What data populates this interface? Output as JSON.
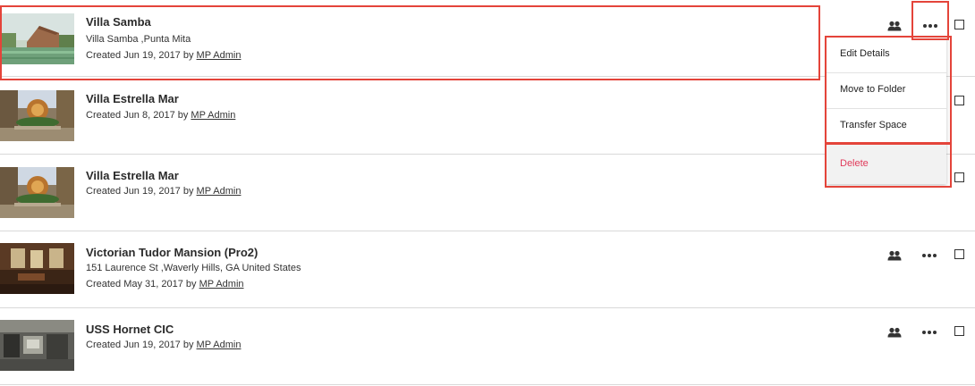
{
  "spaces": [
    {
      "title": "Villa Samba",
      "address": "Villa Samba ,Punta Mita",
      "created_prefix": "Created Jun 19, 2017 by ",
      "created_by": "MP Admin",
      "thumb_icon": "villa-samba-photo"
    },
    {
      "title": "Villa Estrella Mar",
      "address": "",
      "created_prefix": "Created Jun 8, 2017 by ",
      "created_by": "MP Admin",
      "thumb_icon": "villa-estrella-photo"
    },
    {
      "title": "Villa Estrella Mar",
      "address": "",
      "created_prefix": "Created Jun 19, 2017 by ",
      "created_by": "MP Admin",
      "thumb_icon": "villa-estrella-photo"
    },
    {
      "title": "Victorian Tudor Mansion (Pro2)",
      "address": "151 Laurence St ,Waverly Hills, GA United States",
      "created_prefix": "Created May 31, 2017 by ",
      "created_by": "MP Admin",
      "thumb_icon": "mansion-interior-photo"
    },
    {
      "title": "USS Hornet CIC",
      "address": "",
      "created_prefix": "Created Jun 19, 2017 by ",
      "created_by": "MP Admin",
      "thumb_icon": "ship-interior-photo"
    }
  ],
  "context_menu": {
    "items": [
      {
        "label": "Edit Details"
      },
      {
        "label": "Move to Folder"
      },
      {
        "label": "Transfer Space"
      },
      {
        "label": "Delete"
      }
    ]
  },
  "icons": {
    "users": "users-icon",
    "more": "more-options-icon",
    "select": "checkbox"
  },
  "colors": {
    "highlight": "#e4443a",
    "delete_text": "#e03a5a",
    "divider": "#d9d9d9"
  }
}
